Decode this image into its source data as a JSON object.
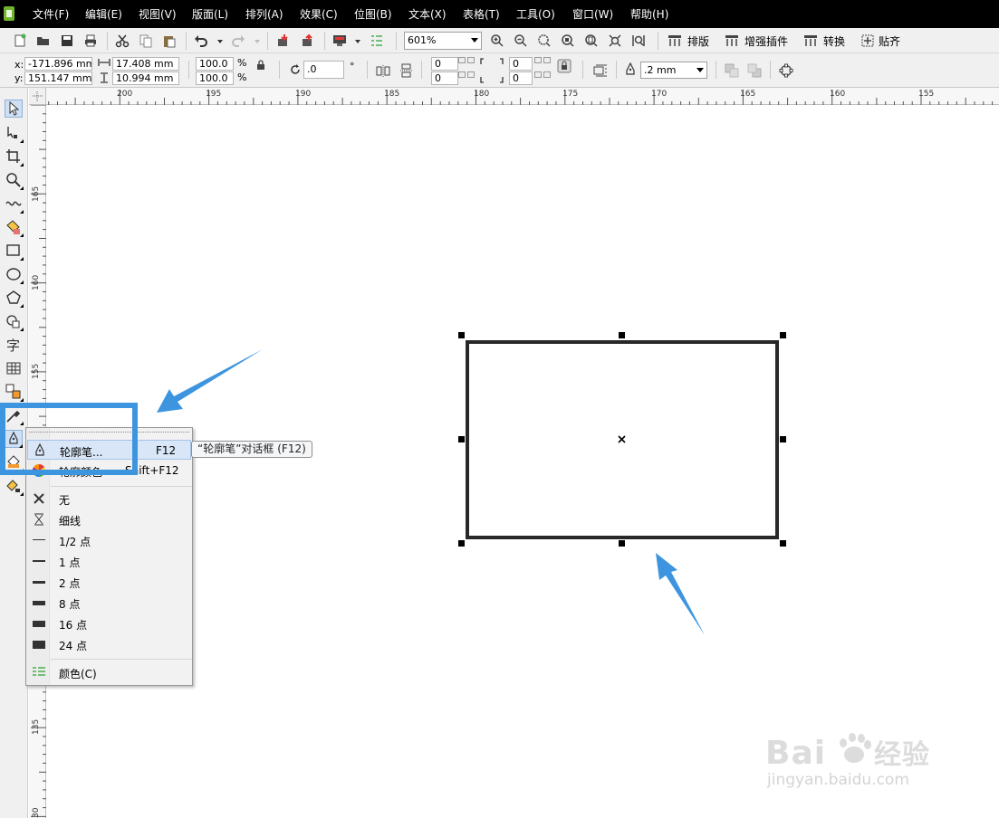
{
  "menubar": {
    "items": [
      "文件(F)",
      "编辑(E)",
      "视图(V)",
      "版面(L)",
      "排列(A)",
      "效果(C)",
      "位图(B)",
      "文本(X)",
      "表格(T)",
      "工具(O)",
      "窗口(W)",
      "帮助(H)"
    ]
  },
  "toolbar": {
    "zoom": "601%",
    "plugins": {
      "layout": "排版",
      "enhance": "增强插件",
      "convert": "转换",
      "snap": "贴齐"
    }
  },
  "property_bar": {
    "x_label": "x:",
    "x": "-171.896 mm",
    "y_label": "y:",
    "y": "151.147 mm",
    "width": "17.408 mm",
    "height": "10.994 mm",
    "scale_x": "100.0",
    "scale_y": "100.0",
    "percent": "%",
    "rotation": ".0",
    "degree": "°",
    "corner_tl": "0",
    "corner_bl": "0",
    "corner_tr": "0",
    "corner_br": "0",
    "outline_width": ".2 mm"
  },
  "ruler": {
    "h_labels": [
      "200",
      "195",
      "190",
      "185",
      "180",
      "175",
      "170",
      "165",
      "160",
      "155"
    ],
    "v_labels": [
      "165",
      "160",
      "155",
      "150",
      "145",
      "140",
      "135",
      "30"
    ]
  },
  "outline_menu": {
    "items": [
      {
        "label": "轮廓笔...",
        "shortcut": "F12"
      },
      {
        "label": "轮廓颜色",
        "shortcut": "Shift+F12"
      },
      {
        "label": "无"
      },
      {
        "label": "细线"
      },
      {
        "label": "1/2 点"
      },
      {
        "label": "1 点"
      },
      {
        "label": "2 点"
      },
      {
        "label": "8 点"
      },
      {
        "label": "16 点"
      },
      {
        "label": "24 点"
      },
      {
        "label": "颜色(C)"
      }
    ]
  },
  "tooltip": "“轮廓笔”对话框 (F12)",
  "watermark": {
    "logo": "Bai经验",
    "url": "jingyan.baidu.com"
  },
  "colors": {
    "highlight": "#3e95df",
    "arrow": "#3e95df",
    "menu_highlight": "#d8e6f7"
  }
}
